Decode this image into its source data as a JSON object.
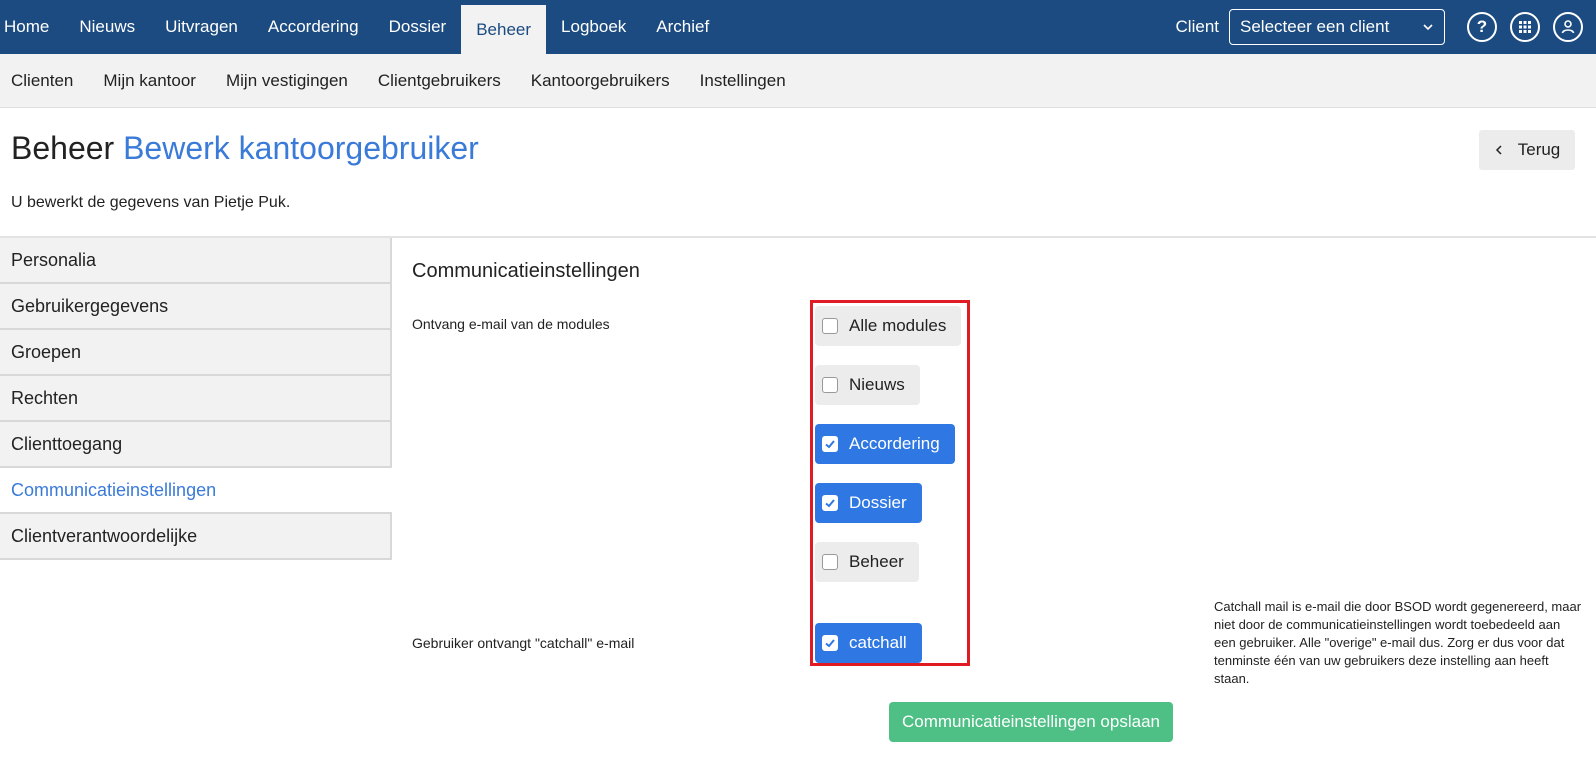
{
  "topnav": {
    "items": [
      "Home",
      "Nieuws",
      "Uitvragen",
      "Accordering",
      "Dossier",
      "Beheer",
      "Logboek",
      "Archief"
    ],
    "active": "Beheer",
    "client_label": "Client",
    "client_select_value": "Selecteer een client"
  },
  "subnav": {
    "items": [
      "Clienten",
      "Mijn kantoor",
      "Mijn vestigingen",
      "Clientgebruikers",
      "Kantoorgebruikers",
      "Instellingen"
    ]
  },
  "header": {
    "title": "Beheer",
    "subtitle": "Bewerk kantoorgebruiker",
    "back_label": "Terug",
    "intro": "U bewerkt de gegevens van Pietje Puk."
  },
  "sidebar": {
    "items": [
      "Personalia",
      "Gebruikergegevens",
      "Groepen",
      "Rechten",
      "Clienttoegang",
      "Communicatieinstellingen",
      "Clientverantwoordelijke"
    ],
    "active": "Communicatieinstellingen"
  },
  "main": {
    "section_title": "Communicatieinstellingen",
    "modules_label": "Ontvang e-mail van de modules",
    "modules": [
      {
        "label": "Alle modules",
        "checked": false
      },
      {
        "label": "Nieuws",
        "checked": false
      },
      {
        "label": "Accordering",
        "checked": true
      },
      {
        "label": "Dossier",
        "checked": true
      },
      {
        "label": "Beheer",
        "checked": false
      }
    ],
    "catchall_label": "Gebruiker ontvangt \"catchall\" e-mail",
    "catchall": {
      "label": "catchall",
      "checked": true
    },
    "help_text": "Catchall mail is e-mail die door BSOD wordt gegenereerd, maar niet door de communicatieinstellingen wordt toebedeeld aan een gebruiker. Alle \"overige\" e-mail dus. Zorg er dus voor dat tenminste één van uw gebruikers deze instelling aan heeft staan.",
    "save_label": "Communicatieinstellingen opslaan"
  },
  "colors": {
    "topbar": "#1b4b80",
    "accent_blue": "#2f78e3",
    "link_blue": "#3a7ad8",
    "save_green": "#4ebf85",
    "highlight_red": "#e01b24"
  },
  "icons": [
    "chevron-down-icon",
    "help-icon",
    "apps-grid-icon",
    "user-icon",
    "chevron-left-icon",
    "checkmark-icon"
  ]
}
